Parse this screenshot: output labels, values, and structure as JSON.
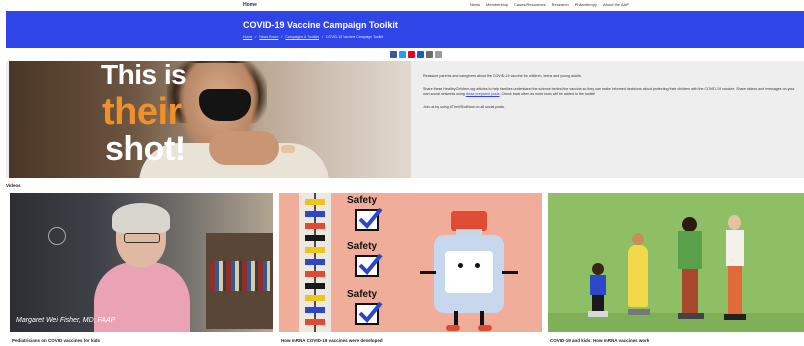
{
  "nav": {
    "logo": "Home",
    "links": [
      "News",
      "Membership",
      "Cases/Resources",
      "Research",
      "Philanthropy",
      "About the AAP"
    ]
  },
  "banner": {
    "title": "COVID-19 Vaccine Campaign Toolkit",
    "breadcrumbs": [
      "Home",
      "News Room",
      "Campaigns & Toolkits",
      "COVID-19 Vaccine Campaign Toolkit"
    ]
  },
  "share": {
    "icons": [
      "facebook-icon",
      "twitter-icon",
      "pinterest-icon",
      "linkedin-icon",
      "email-icon",
      "print-icon"
    ],
    "colors": [
      "#3b5998",
      "#1da1f2",
      "#e60023",
      "#0a66c2",
      "#6d6d6d",
      "#9a9a9a"
    ]
  },
  "hero": {
    "headline_line1": "This is",
    "headline_line2": "their",
    "headline_line3": "shot!",
    "paragraph1": "Reassure parents and caregivers about the COVID-19 vaccine for children, teens and young adults.",
    "paragraph2_start": "Share these HealthyChildren.org articles to help families understand the science behind the vaccine so they can make informed decisions about protecting their children with the COVID-19 vaccine. Share videos and messages on your own social networks using",
    "paragraph2_link": "these prepared posts",
    "paragraph2_end": ". Check back often as more tools will be added to the toolkit!",
    "paragraph3": "Join us by using #TheirShotNow on all social posts."
  },
  "videos": {
    "section_label": "Videos",
    "items": [
      {
        "caption": "Pediatricians on COVID vaccines for kids",
        "name_tag": "Margaret Wei Fisher, MD, FAAP"
      },
      {
        "caption": "How mRNA COVID-19 vaccines were developed",
        "safety_word": "Safety"
      },
      {
        "caption": "COVID-19 and kids: How mRNA vaccines work"
      }
    ]
  }
}
